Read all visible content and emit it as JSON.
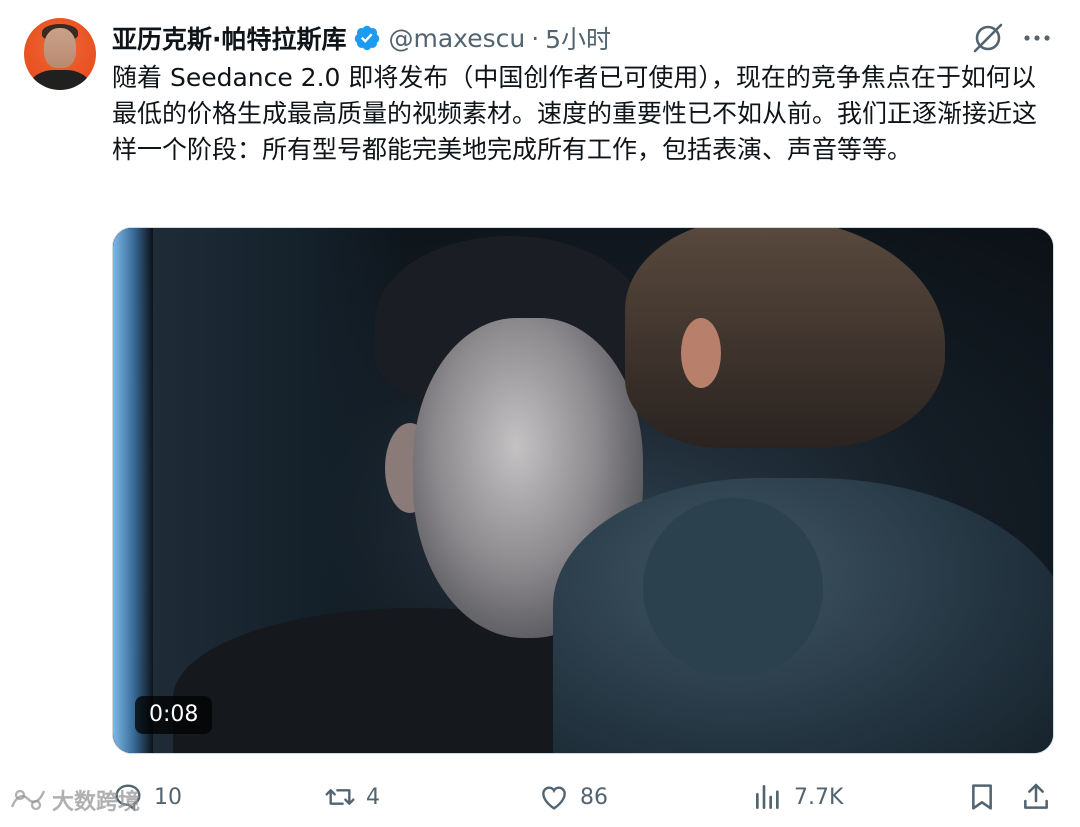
{
  "tweet": {
    "author_name": "亚历克斯·帕特拉斯库",
    "handle": "@maxescu",
    "separator": "·",
    "time": "5小时",
    "text": "随着 Seedance 2.0 即将发布（中国创作者已可使用），现在的竞争焦点在于如何以最低的价格生成最高质量的视频素材。速度的重要性已不如从前。我们正逐渐接近这样一个阶段：所有型号都能完美地完成所有工作，包括表演、声音等等。",
    "verified_color": "#1d9bf0"
  },
  "media": {
    "duration": "0:08"
  },
  "actions": {
    "replies": "10",
    "retweets": "4",
    "likes": "86",
    "views": "7.7K"
  },
  "icons": {
    "header": [
      "grok-icon",
      "more-icon"
    ],
    "actions": [
      "reply-icon",
      "retweet-icon",
      "like-icon",
      "views-icon",
      "bookmark-icon",
      "share-icon"
    ]
  },
  "watermark": {
    "text": "大数跨境"
  }
}
